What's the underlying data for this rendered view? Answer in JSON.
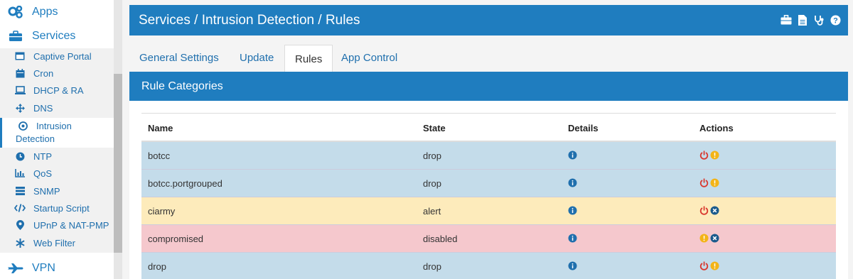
{
  "sidebar": {
    "apps_label": "Apps",
    "services_label": "Services",
    "items": [
      {
        "label": "Captive Portal"
      },
      {
        "label": "Cron"
      },
      {
        "label": "DHCP & RA"
      },
      {
        "label": "DNS"
      },
      {
        "label_line1": "Intrusion",
        "label_line2": "Detection"
      },
      {
        "label": "NTP"
      },
      {
        "label": "QoS"
      },
      {
        "label": "SNMP"
      },
      {
        "label": "Startup Script"
      },
      {
        "label": "UPnP & NAT-PMP"
      },
      {
        "label": "Web Filter"
      }
    ],
    "vpn_label": "VPN"
  },
  "header": {
    "title": "Services / Intrusion Detection / Rules"
  },
  "tabs": [
    {
      "label": "General Settings"
    },
    {
      "label": "Update"
    },
    {
      "label": "Rules"
    },
    {
      "label": "App Control"
    }
  ],
  "panel": {
    "title": "Rule Categories",
    "columns": {
      "name": "Name",
      "state": "State",
      "details": "Details",
      "actions": "Actions"
    },
    "rows": [
      {
        "name": "botcc",
        "state": "drop"
      },
      {
        "name": "botcc.portgrouped",
        "state": "drop"
      },
      {
        "name": "ciarmy",
        "state": "alert"
      },
      {
        "name": "compromised",
        "state": "disabled"
      },
      {
        "name": "drop",
        "state": "drop"
      }
    ]
  },
  "colors": {
    "primary": "#1f7dbf",
    "row_drop": "#c4dcea",
    "row_alert": "#fdebbb",
    "row_disabled": "#f5c8cd",
    "power_red": "#d9372e",
    "warn_yellow": "#f3b417",
    "close_blue": "#1a5a8c"
  }
}
